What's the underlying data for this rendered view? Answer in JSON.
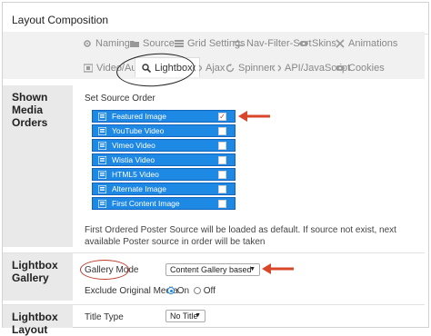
{
  "panel": {
    "title": "Layout Composition"
  },
  "tabs": [
    {
      "label": "Naming",
      "icon": "gear-icon"
    },
    {
      "label": "Source",
      "icon": "folder-icon"
    },
    {
      "label": "Grid Settings",
      "icon": "grid-icon"
    },
    {
      "label": "Nav-Filter-Sort",
      "icon": "shuffle-icon"
    },
    {
      "label": "Skins",
      "icon": "eye-icon"
    },
    {
      "label": "Animations",
      "icon": "tools-icon"
    },
    {
      "label": "Video/Audio",
      "icon": "film-icon"
    },
    {
      "label": "Lightbox",
      "icon": "search-icon"
    },
    {
      "label": "Ajax",
      "icon": "code-icon"
    },
    {
      "label": "Spinner",
      "icon": "refresh-icon"
    },
    {
      "label": "API/JavaScript",
      "icon": "code-icon"
    },
    {
      "label": "Cookies",
      "icon": "eye-icon"
    }
  ],
  "active_tab": "Lightbox",
  "shown_media": {
    "label": "Shown Media Orders",
    "caption": "Set Source Order",
    "items": [
      {
        "label": "Featured Image",
        "checked": true
      },
      {
        "label": "YouTube Video",
        "checked": false
      },
      {
        "label": "Vimeo Video",
        "checked": false
      },
      {
        "label": "Wistia Video",
        "checked": false
      },
      {
        "label": "HTML5 Video",
        "checked": false
      },
      {
        "label": "Alternate Image",
        "checked": false
      },
      {
        "label": "First Content Image",
        "checked": false
      }
    ],
    "note": "First Ordered Poster Source will be loaded as default. If source not exist, next available Poster source in order will be taken",
    "checkmark": "✓"
  },
  "lightbox_gallery": {
    "label": "Lightbox Gallery",
    "gallery_mode_label": "Gallery Mode",
    "gallery_mode_value": "Content Gallery based",
    "exclude_label": "Exclude Original Media",
    "on_label": "On",
    "off_label": "Off",
    "exclude_value": "On"
  },
  "lightbox_layout": {
    "label": "Lightbox Layout",
    "title_type_label": "Title Type",
    "title_type_value": "No Title"
  },
  "colors": {
    "accent": "#1e88e5",
    "annotation_red": "#d9472b",
    "section_bg": "#e9e9e9"
  }
}
